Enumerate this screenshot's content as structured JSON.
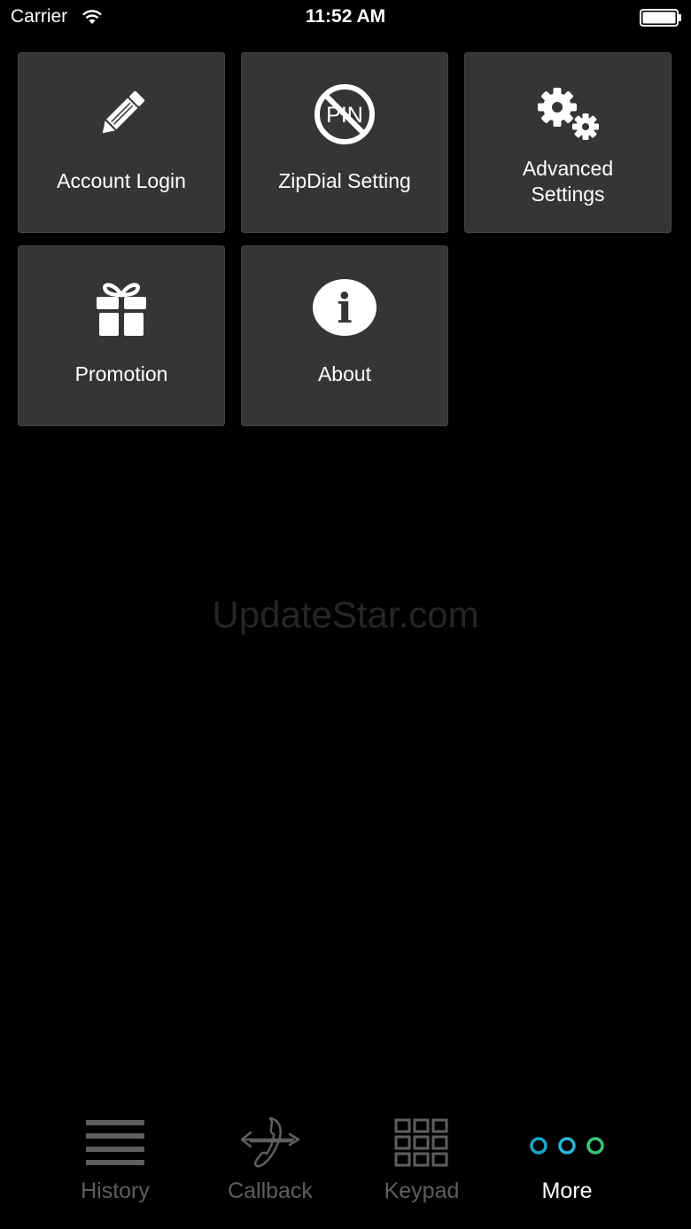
{
  "status_bar": {
    "carrier": "Carrier",
    "time": "11:52 AM"
  },
  "menu": {
    "tiles": [
      {
        "label": "Account Login",
        "icon": "pencil-icon"
      },
      {
        "label": "ZipDial Setting",
        "icon": "no-pin-icon",
        "icon_text": "PIN"
      },
      {
        "label_line1": "Advanced",
        "label_line2": "Settings",
        "icon": "gears-icon"
      },
      {
        "label": "Promotion",
        "icon": "gift-icon"
      },
      {
        "label": "About",
        "icon": "info-icon",
        "icon_text": "i"
      }
    ]
  },
  "watermark": "UpdateStar.com",
  "tab_bar": {
    "tabs": [
      {
        "label": "History",
        "icon": "list-icon",
        "active": false
      },
      {
        "label": "Callback",
        "icon": "phone-arrows-icon",
        "active": false
      },
      {
        "label": "Keypad",
        "icon": "keypad-grid-icon",
        "active": false
      },
      {
        "label": "More",
        "icon": "more-dots-icon",
        "active": true
      }
    ]
  },
  "colors": {
    "background": "#000000",
    "tile": "#353535",
    "tab_inactive": "#5e5e5e",
    "tab_active": "#ffffff",
    "more_dot_1": "#1aa7c9",
    "more_dot_2": "#2bb5d8",
    "more_dot_3": "#3fc47c"
  }
}
